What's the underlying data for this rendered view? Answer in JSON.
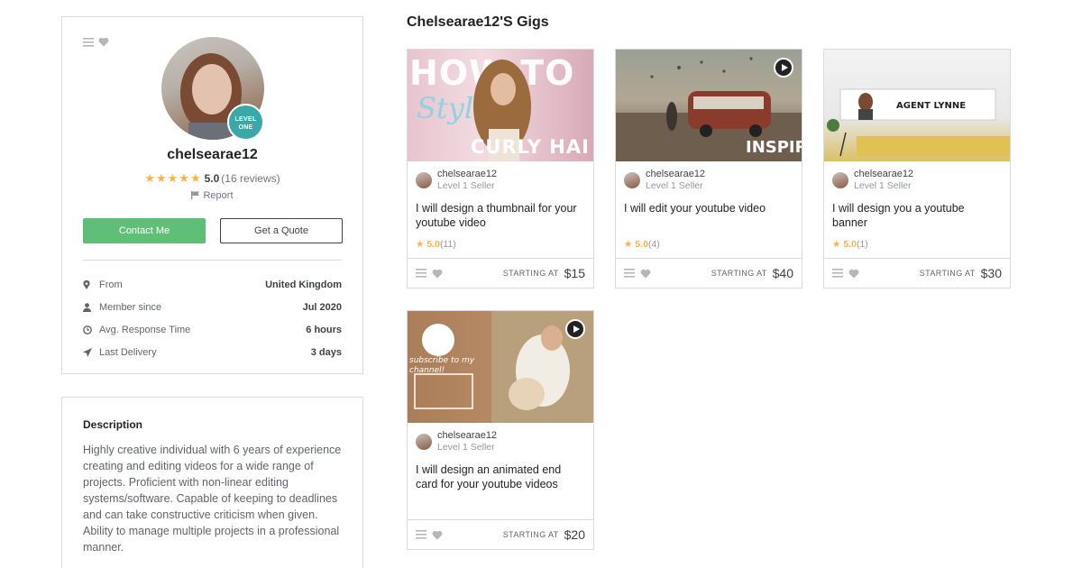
{
  "profile": {
    "username": "chelsearae12",
    "level_badge": "LEVEL ONE",
    "rating": "5.0",
    "reviews": "(16 reviews)",
    "report": "Report",
    "contact_button": "Contact Me",
    "quote_button": "Get a Quote",
    "stats": [
      {
        "label": "From",
        "value": "United Kingdom",
        "icon": "location-pin-icon"
      },
      {
        "label": "Member since",
        "value": "Jul 2020",
        "icon": "user-icon"
      },
      {
        "label": "Avg. Response Time",
        "value": "6 hours",
        "icon": "clock-icon"
      },
      {
        "label": "Last Delivery",
        "value": "3 days",
        "icon": "paper-plane-icon"
      }
    ]
  },
  "description": {
    "title": "Description",
    "text": "Highly creative individual with 6 years of experience creating and editing videos for a wide range of projects. Proficient with non-linear editing systems/software. Capable of keeping to deadlines and can take constructive criticism when given. Ability to manage multiple projects in a professional manner."
  },
  "gigs_title": "Chelsearae12'S Gigs",
  "gigs": [
    {
      "seller": "chelsearae12",
      "level": "Level 1 Seller",
      "title": "I will design a thumbnail for your youtube video",
      "rating": "5.0",
      "count": "(11)",
      "starting": "STARTING AT",
      "price": "$15",
      "thumb_text_1": "HOW TO",
      "thumb_text_2": "Style",
      "thumb_text_3": "CURLY HAI"
    },
    {
      "seller": "chelsearae12",
      "level": "Level 1 Seller",
      "title": "I will edit your youtube video",
      "rating": "5.0",
      "count": "(4)",
      "starting": "STARTING AT",
      "price": "$40",
      "thumb_text_1": "INSPIRIN"
    },
    {
      "seller": "chelsearae12",
      "level": "Level 1 Seller",
      "title": "I will design you a youtube banner",
      "rating": "5.0",
      "count": "(1)",
      "starting": "STARTING AT",
      "price": "$30",
      "thumb_text_1": "AGENT LYNNE"
    },
    {
      "seller": "chelsearae12",
      "level": "Level 1 Seller",
      "title": "I will design an animated end card for your youtube videos",
      "starting": "STARTING AT",
      "price": "$20",
      "thumb_text_1": "subscribe to my channel!"
    }
  ],
  "colors": {
    "accent_green": "#5fbf76",
    "star": "#ffb33e",
    "badge": "#3aa8a7"
  }
}
